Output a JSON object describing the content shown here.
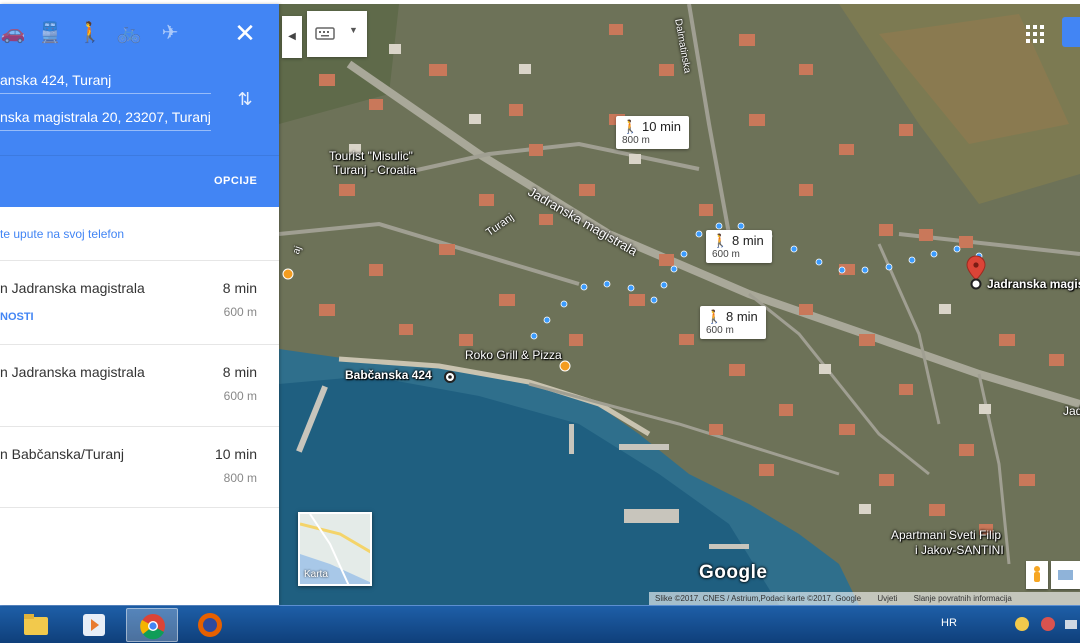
{
  "panel": {
    "modes": [
      {
        "name": "car-icon",
        "glyph": "🚗"
      },
      {
        "name": "transit-icon",
        "glyph": "🚆"
      },
      {
        "name": "walk-icon",
        "glyph": "🚶"
      },
      {
        "name": "bicycle-icon",
        "glyph": "🚲"
      },
      {
        "name": "flight-icon",
        "glyph": "✈"
      }
    ],
    "active_mode": "walk",
    "close_glyph": "✕",
    "origin": "anska 424, Turanj",
    "destination": "nska magistrala 20, 23207, Turanj",
    "swap_glyph": "⇅",
    "options_label": "OPCIJE",
    "send_link": "te upute na svoj telefon",
    "routes": [
      {
        "via": "n Jadranska magistrala",
        "time": "8 min",
        "distance": "600 m",
        "details": "NOSTI"
      },
      {
        "via": "n Jadranska magistrala",
        "time": "8 min",
        "distance": "600 m",
        "details": ""
      },
      {
        "via": "n Babčanska/Turanj",
        "time": "10 min",
        "distance": "800 m",
        "details": ""
      }
    ]
  },
  "map": {
    "labels": {
      "origin": "Babčanska 424",
      "destination": "Jadranska magistrala",
      "restaurant": "Roko Grill & Pizza",
      "tourist_line1": "Tourist \"Misulic\"",
      "tourist_line2": "Turanj - Croatia",
      "apartments_line1": "Apartmani Sveti Filip",
      "apartments_line2": "i Jakov-SANTINI",
      "road_main": "Jadranska magistrala",
      "road_turanj": "Turanj",
      "road_dalmatinska": "Dalmatinska",
      "road_edge_left": "aj",
      "road_edge_right": "Jad"
    },
    "callouts": [
      {
        "time": "10 min",
        "distance": "800 m"
      },
      {
        "time": "8 min",
        "distance": "600 m"
      },
      {
        "time": "8 min",
        "distance": "600 m"
      }
    ],
    "walk_glyph": "🚶",
    "collapse_glyph": "◀",
    "keyboard_dropdown_glyph": "▼",
    "layer_label": "Karta",
    "google_logo": "Google",
    "attribution": [
      "Slike ©2017. CNES / Astrium,Podaci karte ©2017. Google",
      "Uvjeti",
      "Slanje povratnih informacija"
    ]
  },
  "taskbar": {
    "apps": [
      "file-explorer-icon",
      "media-player-icon",
      "chrome-icon",
      "firefox-icon"
    ],
    "active_app": "chrome-icon",
    "language": "HR"
  },
  "colors": {
    "accent": "#4285f4",
    "route_dots": "#3b9cff",
    "destination_pin": "#db4437"
  }
}
